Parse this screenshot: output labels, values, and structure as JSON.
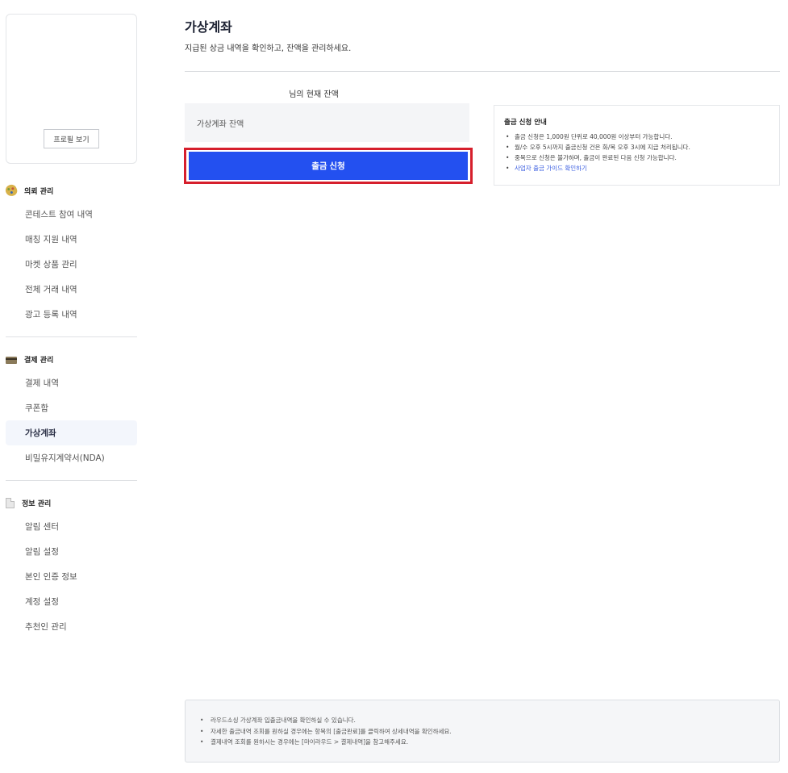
{
  "sidebar": {
    "profile_button": "프로필 보기",
    "sections": [
      {
        "title": "의뢰 관리",
        "icon": "palette-icon",
        "items": [
          "콘테스트 참여 내역",
          "매칭 지원 내역",
          "마켓 상품 관리",
          "전체 거래 내역",
          "광고 등록 내역"
        ]
      },
      {
        "title": "결제 관리",
        "icon": "credit-card-icon",
        "items": [
          "결제 내역",
          "쿠폰함",
          "가상계좌",
          "비밀유지계약서(NDA)"
        ],
        "active_item": "가상계좌"
      },
      {
        "title": "정보 관리",
        "icon": "document-icon",
        "items": [
          "알림 센터",
          "알림 설정",
          "본인 인증 정보",
          "계정 설정",
          "추천인 관리"
        ]
      }
    ]
  },
  "main": {
    "title": "가상계좌",
    "subtitle": "지급된 상금 내역을 확인하고, 잔액을 관리하세요.",
    "balance_heading": "님의 현재 잔액",
    "balance_label": "가상계좌 잔액",
    "withdraw_button": "출금 신청"
  },
  "guide": {
    "title": "출금 신청 안내",
    "items": [
      "출금 신청은 1,000원 단위로 40,000원 이상부터 가능합니다.",
      "월/수 오후 5시까지 출금신청 건은 화/목 오후 3시에 지급 처리됩니다.",
      "중복으로 신청은 불가하며, 출금이 완료된 다음 신청 가능합니다."
    ],
    "link": "사업자 출금 가이드 확인하기"
  },
  "notice": {
    "items": [
      "라우드소싱 가상계좌 입출금내역을 확인하실 수 있습니다.",
      "자세한 출금내역 조회를 원하실 경우에는 항목의 [출금완료]를 클릭하여 상세내역을 확인하세요.",
      "결제내역 조회를 원하시는 경우에는 [마이라우드 > 결제내역]을 참고해주세요."
    ]
  }
}
